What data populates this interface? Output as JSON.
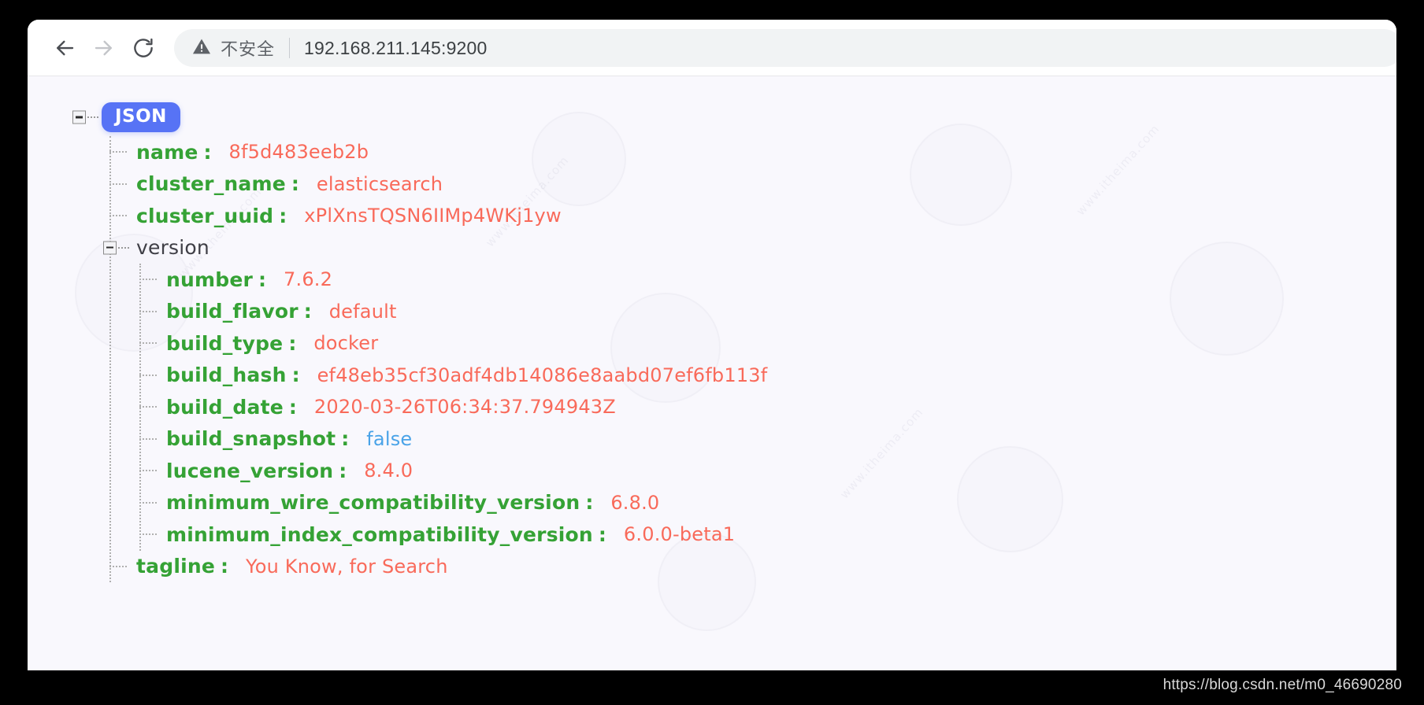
{
  "browser": {
    "back_icon": "arrow-left-icon",
    "forward_icon": "arrow-right-icon",
    "reload_icon": "reload-icon",
    "security_icon": "warning-triangle-icon",
    "security_label": "不安全",
    "url": "192.168.211.145:9200"
  },
  "viewer": {
    "root_label": "JSON",
    "collapse_icon": "minus-box-icon",
    "colon": ":"
  },
  "json": {
    "name": {
      "key": "name",
      "value": "8f5d483eeb2b"
    },
    "cluster_name": {
      "key": "cluster_name",
      "value": "elasticsearch"
    },
    "cluster_uuid": {
      "key": "cluster_uuid",
      "value": "xPlXnsTQSN6IIMp4WKj1yw"
    },
    "version": {
      "key": "version",
      "children": {
        "number": {
          "key": "number",
          "value": "7.6.2"
        },
        "build_flavor": {
          "key": "build_flavor",
          "value": "default"
        },
        "build_type": {
          "key": "build_type",
          "value": "docker"
        },
        "build_hash": {
          "key": "build_hash",
          "value": "ef48eb35cf30adf4db14086e8aabd07ef6fb113f"
        },
        "build_date": {
          "key": "build_date",
          "value": "2020-03-26T06:34:37.794943Z"
        },
        "build_snapshot": {
          "key": "build_snapshot",
          "value": "false"
        },
        "lucene_version": {
          "key": "lucene_version",
          "value": "8.4.0"
        },
        "minimum_wire_compatibility_version": {
          "key": "minimum_wire_compatibility_version",
          "value": "6.8.0"
        },
        "minimum_index_compatibility_version": {
          "key": "minimum_index_compatibility_version",
          "value": "6.0.0-beta1"
        }
      }
    },
    "tagline": {
      "key": "tagline",
      "value": "You Know, for Search"
    }
  },
  "footer": {
    "url": "https://blog.csdn.net/m0_46690280"
  },
  "colors": {
    "badge": "#5773f5",
    "key": "#35a235",
    "value": "#f96a5a",
    "boolean": "#4aa3e8",
    "object": "#3f3f46",
    "content_bg": "#f9f8fd"
  }
}
